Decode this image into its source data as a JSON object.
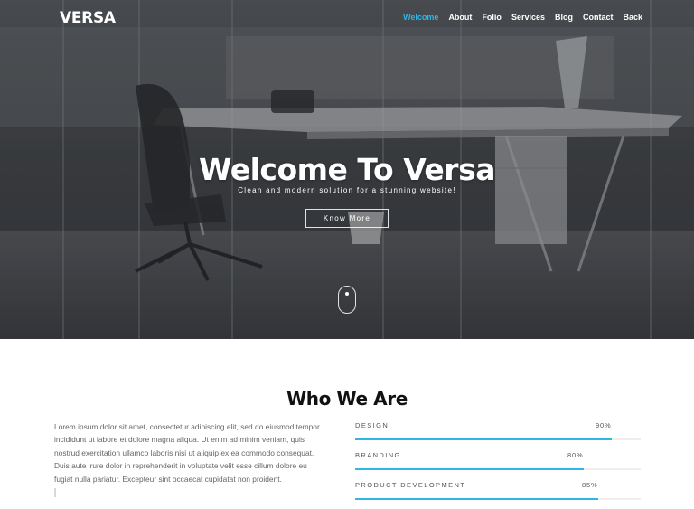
{
  "header": {
    "logo": "VERSA",
    "nav": [
      {
        "label": "Welcome",
        "active": true
      },
      {
        "label": "About",
        "active": false
      },
      {
        "label": "Folio",
        "active": false
      },
      {
        "label": "Services",
        "active": false
      },
      {
        "label": "Blog",
        "active": false
      },
      {
        "label": "Contact",
        "active": false
      },
      {
        "label": "Back",
        "active": false
      }
    ]
  },
  "hero": {
    "title": "Welcome To Versa",
    "subtitle": "Clean and modern solution for a stunning website!",
    "button_label": "Know More",
    "scroll_icon": "mouse-scroll-icon"
  },
  "about": {
    "title": "Who We Are",
    "text": "Lorem ipsum dolor sit amet, consectetur adipiscing elit, sed do eiusmod tempor incididunt ut labore et dolore magna aliqua. Ut enim ad minim veniam, quis nostrud exercitation ullamco laboris nisi ut aliquip ex ea commodo consequat. Duis aute irure dolor in reprehenderit in voluptate velit esse cillum dolore eu fugiat nulla pariatur. Excepteur sint occaecat cupidatat non proident.",
    "skills": [
      {
        "name": "DESIGN",
        "value": 90,
        "label": "90%"
      },
      {
        "name": "BRANDING",
        "value": 80,
        "label": "80%"
      },
      {
        "name": "PRODUCT DEVELOPMENT",
        "value": 85,
        "label": "85%"
      }
    ]
  },
  "colors": {
    "accent": "#2fb5e6",
    "hero_overlay": "#3c3f43",
    "heading": "#111111",
    "body_text": "#666666"
  }
}
